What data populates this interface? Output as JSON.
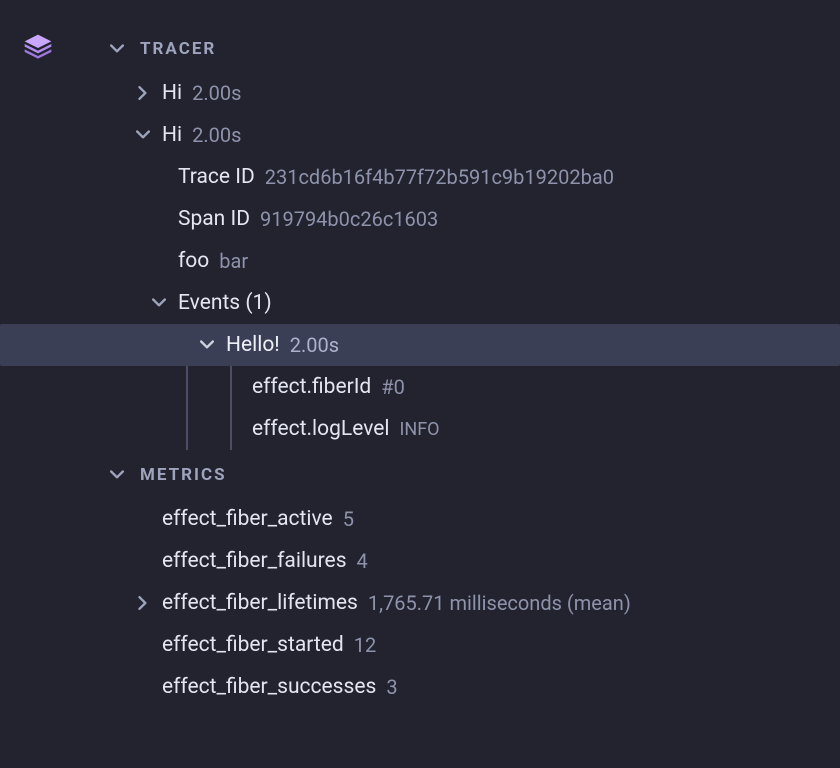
{
  "tracer": {
    "label": "TRACER",
    "spans": [
      {
        "name": "Hi",
        "duration": "2.00s"
      },
      {
        "name": "Hi",
        "duration": "2.00s"
      }
    ],
    "details": {
      "traceId": {
        "label": "Trace ID",
        "value": "231cd6b16f4b77f72b591c9b19202ba0"
      },
      "spanId": {
        "label": "Span ID",
        "value": "919794b0c26c1603"
      },
      "foo": {
        "label": "foo",
        "value": "bar"
      }
    },
    "events": {
      "label": "Events (1)",
      "items": [
        {
          "name": "Hello!",
          "duration": "2.00s",
          "fiberId": {
            "label": "effect.fiberId",
            "value": "#0"
          },
          "logLevel": {
            "label": "effect.logLevel",
            "value": "INFO"
          }
        }
      ]
    }
  },
  "metrics": {
    "label": "METRICS",
    "items": [
      {
        "label": "effect_fiber_active",
        "value": "5"
      },
      {
        "label": "effect_fiber_failures",
        "value": "4"
      },
      {
        "label": "effect_fiber_lifetimes",
        "value": "1,765.71 milliseconds (mean)"
      },
      {
        "label": "effect_fiber_started",
        "value": "12"
      },
      {
        "label": "effect_fiber_successes",
        "value": "3"
      }
    ]
  }
}
